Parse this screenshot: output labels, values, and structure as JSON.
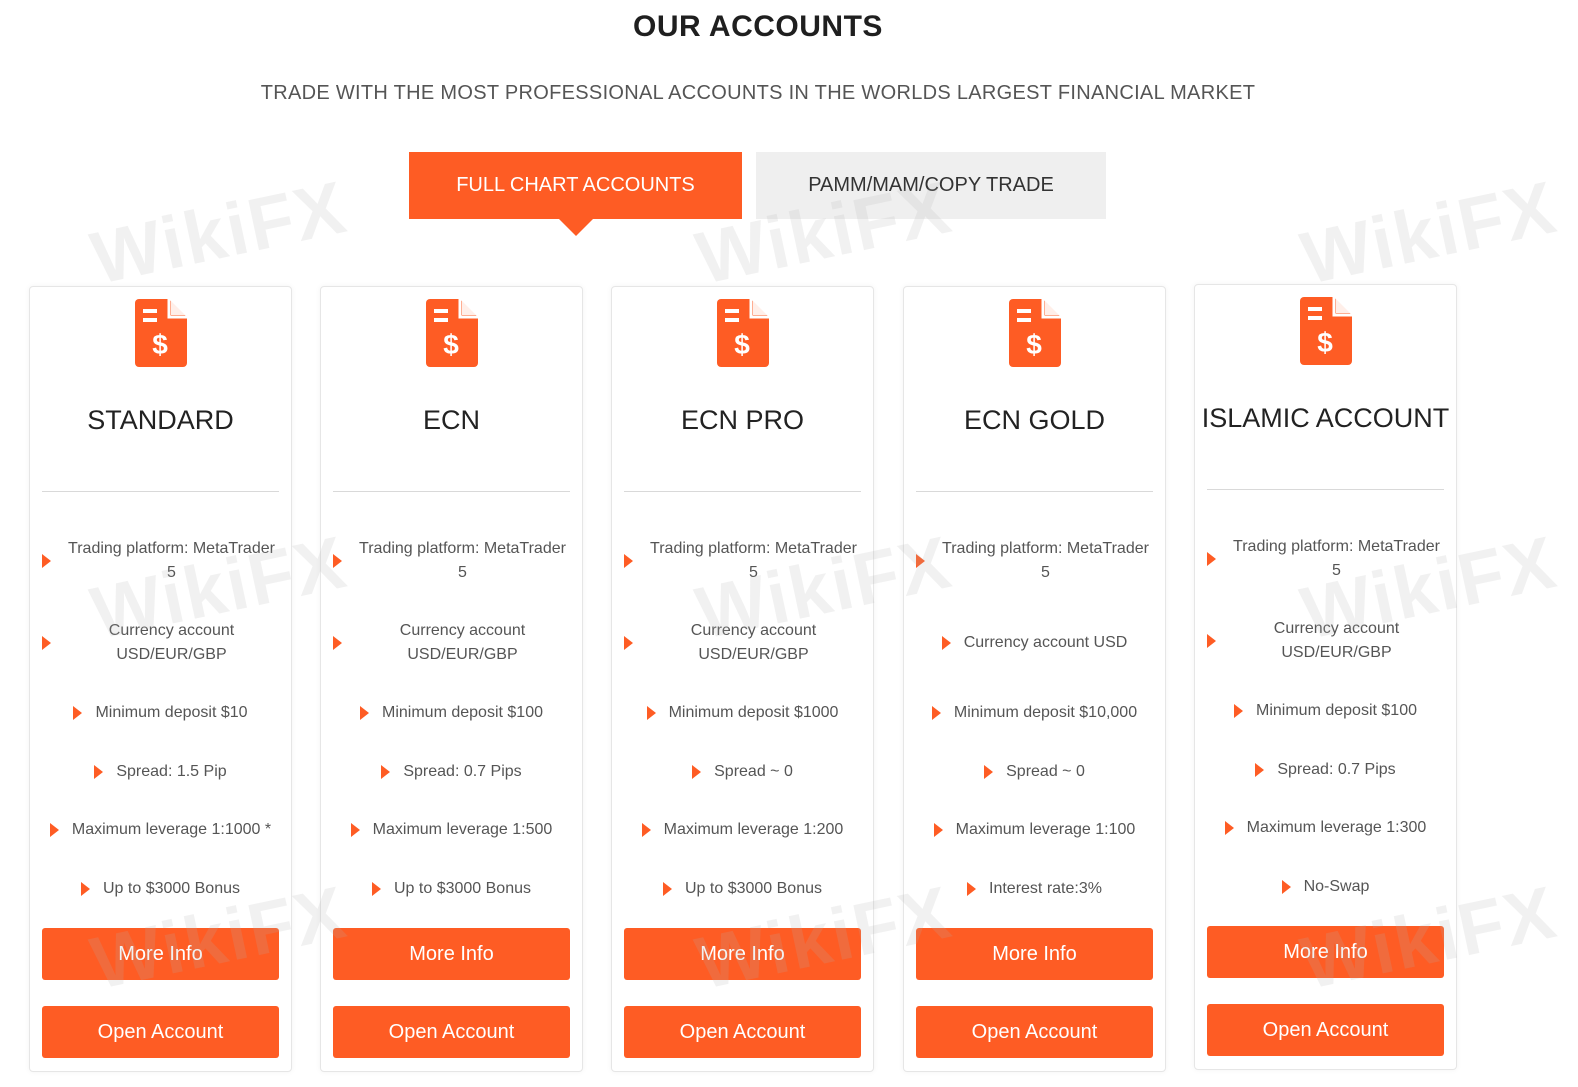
{
  "header": {
    "title": "OUR ACCOUNTS",
    "subtitle": "TRADE WITH THE MOST PROFESSIONAL ACCOUNTS IN THE WORLDS LARGEST FINANCIAL MARKET"
  },
  "tabs": [
    {
      "label": "FULL CHART ACCOUNTS",
      "active": true
    },
    {
      "label": "PAMM/MAM/COPY TRADE",
      "active": false
    }
  ],
  "theme": {
    "accent": "#fe5c24"
  },
  "watermark": "WikiFX",
  "cards": [
    {
      "name": "STANDARD",
      "icon": "dollar-document-icon",
      "features": [
        "Trading platform: MetaTrader 5",
        "Currency account USD/EUR/GBP",
        "Minimum deposit $10",
        "Spread: 1.5 Pip",
        "Maximum leverage 1:1000 *",
        "Up to $3000 Bonus"
      ],
      "more_info": "More Info",
      "open_account": "Open Account"
    },
    {
      "name": "ECN",
      "icon": "dollar-document-icon",
      "features": [
        "Trading platform: MetaTrader 5",
        "Currency account USD/EUR/GBP",
        "Minimum deposit $100",
        "Spread: 0.7 Pips",
        "Maximum leverage 1:500",
        "Up to $3000 Bonus"
      ],
      "more_info": "More Info",
      "open_account": "Open Account"
    },
    {
      "name": "ECN PRO",
      "icon": "dollar-document-icon",
      "features": [
        "Trading platform: MetaTrader 5",
        "Currency account USD/EUR/GBP",
        "Minimum deposit $1000",
        "Spread ~ 0",
        "Maximum leverage 1:200",
        "Up to $3000 Bonus"
      ],
      "more_info": "More Info",
      "open_account": "Open Account"
    },
    {
      "name": "ECN GOLD",
      "icon": "dollar-document-icon",
      "features": [
        "Trading platform: MetaTrader 5",
        "Currency account USD",
        "Minimum deposit $10,000",
        "Spread ~ 0",
        "Maximum leverage 1:100",
        "Interest rate:3%"
      ],
      "more_info": "More Info",
      "open_account": "Open Account"
    },
    {
      "name": "ISLAMIC ACCOUNT",
      "icon": "dollar-document-icon",
      "features": [
        "Trading platform: MetaTrader 5",
        "Currency account USD/EUR/GBP",
        "Minimum deposit $100",
        "Spread: 0.7 Pips",
        "Maximum leverage 1:300",
        "No-Swap"
      ],
      "more_info": "More Info",
      "open_account": "Open Account"
    }
  ]
}
